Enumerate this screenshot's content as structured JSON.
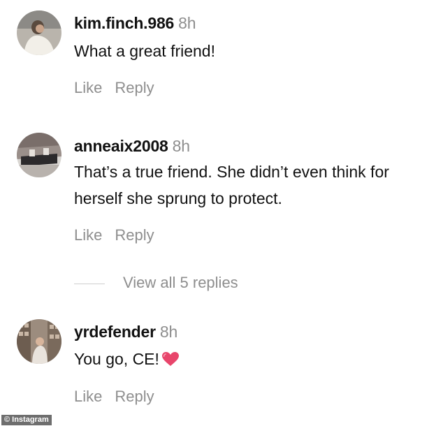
{
  "comments": [
    {
      "username": "kim.finch.986",
      "time": "8h",
      "text": "What a great friend!",
      "like_label": "Like",
      "reply_label": "Reply",
      "avatar_icon": "user-photo-avatar"
    },
    {
      "username": "anneaix2008",
      "time": "8h",
      "text": "That’s a true friend. She didn’t even think for herself she sprung to protect.",
      "like_label": "Like",
      "reply_label": "Reply",
      "avatar_icon": "user-photo-avatar"
    },
    {
      "username": "yrdefender",
      "time": "8h",
      "text": "You go, CE!",
      "emoji": "heart-icon",
      "like_label": "Like",
      "reply_label": "Reply",
      "avatar_icon": "user-photo-avatar"
    }
  ],
  "view_replies": {
    "label": "View all 5 replies"
  },
  "watermark": {
    "text": "© Instagram"
  },
  "colors": {
    "text_primary": "#111111",
    "text_secondary": "#8e8e8e",
    "heart": "#e8456b"
  }
}
